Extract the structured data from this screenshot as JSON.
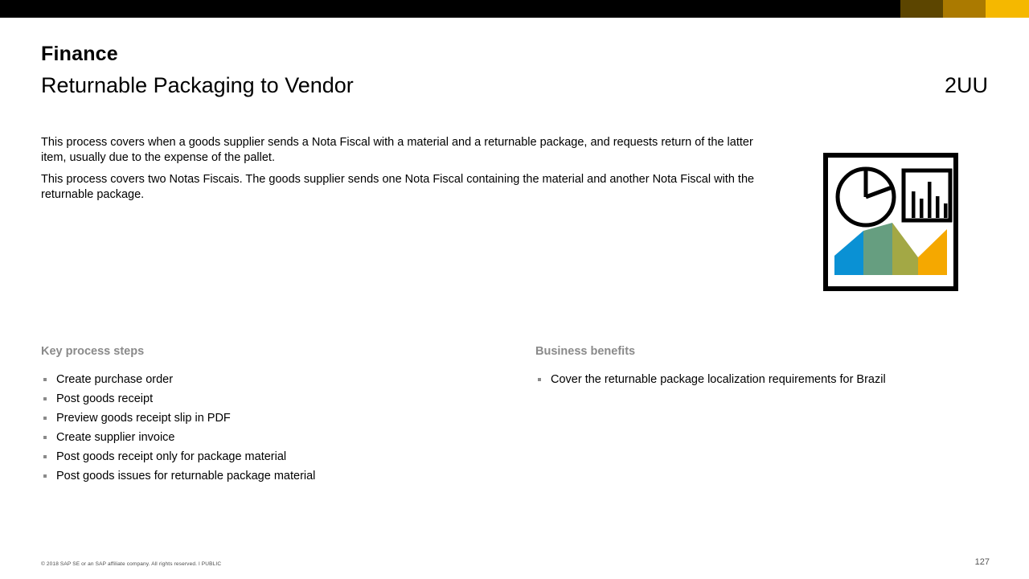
{
  "topbar": {
    "colors": {
      "black": "#000000",
      "olive": "#5c4500",
      "gold": "#ab7a00",
      "amber": "#f5b800"
    }
  },
  "header": {
    "eyebrow": "Finance",
    "title": "Returnable Packaging to Vendor",
    "scope_id": "2UU"
  },
  "intro": {
    "paragraph_1": "This process covers when a goods supplier sends a Nota Fiscal with a material and a returnable package, and requests return of the latter item, usually due to the expense of the pallet.",
    "paragraph_2": "This process covers two Notas Fiscais. The goods supplier sends one Nota Fiscal containing the material and another Nota Fiscal with the returnable package."
  },
  "graphic": {
    "name": "analytics-charts-icon",
    "colors": {
      "blue": "#0a91d4",
      "green": "#669e80",
      "olive": "#a3a845",
      "amber": "#f5a800",
      "outline": "#000000"
    }
  },
  "key_process_steps": {
    "heading": "Key process steps",
    "items": [
      "Create purchase order",
      "Post goods receipt",
      "Preview goods receipt slip in PDF",
      "Create supplier invoice",
      "Post goods receipt only for package material",
      "Post goods issues for returnable package material"
    ]
  },
  "business_benefits": {
    "heading": "Business benefits",
    "items": [
      "Cover the returnable package localization requirements for Brazil"
    ]
  },
  "footer": {
    "copyright": "© 2018 SAP SE or an SAP affiliate company.  All rights reserved.  ǀ  PUBLIC",
    "page_number": "127"
  }
}
